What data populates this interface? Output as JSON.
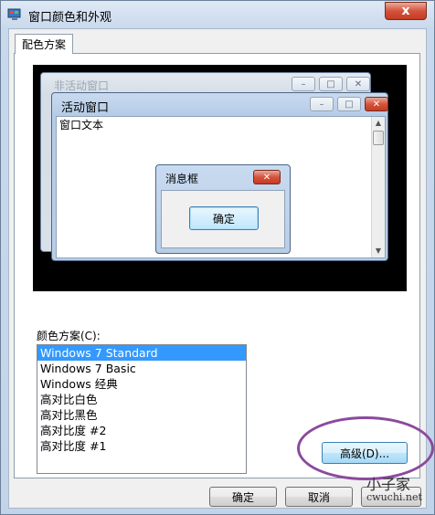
{
  "window": {
    "title": "窗口颜色和外观",
    "close_glyph": "x"
  },
  "tab": {
    "label": "配色方案"
  },
  "preview": {
    "inactive_title": "非活动窗口",
    "active_title": "活动窗口",
    "window_text": "窗口文本",
    "message_box": {
      "title": "消息框",
      "ok_label": "确定"
    }
  },
  "color_scheme": {
    "label": "颜色方案(C):",
    "items": [
      "Windows 7 Standard",
      "Windows 7 Basic",
      "Windows 经典",
      "高对比白色",
      "高对比黑色",
      "高对比度 #2",
      "高对比度 #1"
    ],
    "selected_index": 0
  },
  "buttons": {
    "advanced": "高级(D)...",
    "ok": "确定",
    "cancel": "取消"
  },
  "watermark": {
    "line1": "小子家",
    "line2": "cwuchi.net"
  },
  "colors": {
    "selection": "#3399ff",
    "highlight_ellipse": "#8b4a9e",
    "close_red": "#d5533c"
  },
  "icons": {
    "app": "monitor-palette-icon",
    "minimize": "minimize-icon",
    "maximize": "maximize-icon",
    "close": "close-icon"
  }
}
